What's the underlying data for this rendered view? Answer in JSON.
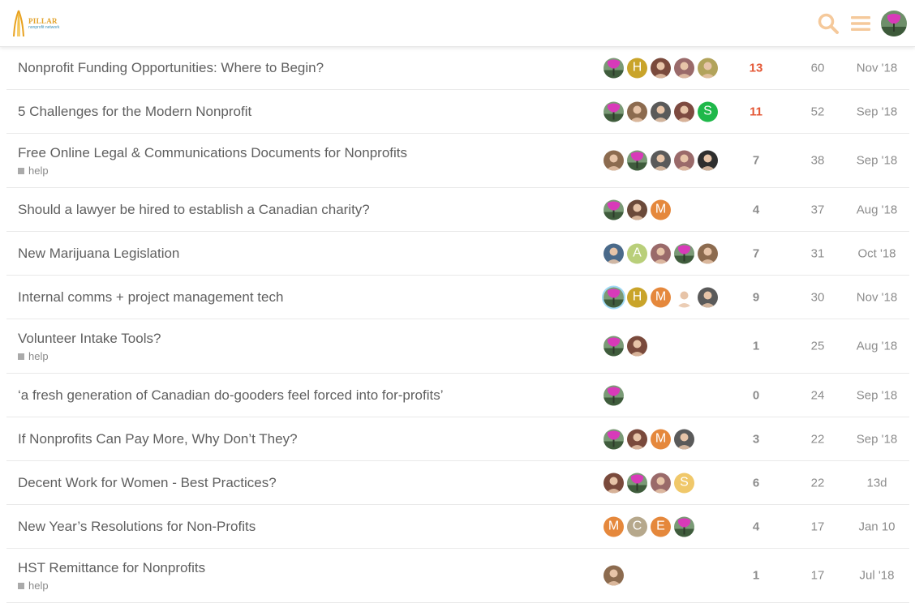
{
  "header": {
    "logo_title": "PILLAR",
    "logo_subtitle": "nonprofit network"
  },
  "colors": {
    "accent": "#f5c99b",
    "hot_replies": "#e45735",
    "magenta": "#d83ab9",
    "avatar_h": "#c9a42a",
    "avatar_m": "#e5883c",
    "avatar_s_green": "#1fb84a",
    "avatar_a": "#b9cf7a",
    "avatar_c": "#b6a88c",
    "avatar_s_yellow": "#f0c86a"
  },
  "topics": [
    {
      "title": "Nonprofit Funding Opportunities: Where to Begin?",
      "tag": "",
      "replies": "13",
      "views": "60",
      "activity": "Nov '18",
      "posters": [
        {
          "type": "flower"
        },
        {
          "type": "letter",
          "letter": "H",
          "color": "#c9a42a"
        },
        {
          "type": "photo",
          "color": "#7a4a3c"
        },
        {
          "type": "photo",
          "color": "#9a6a6a"
        },
        {
          "type": "photo",
          "color": "#b2a35b"
        }
      ]
    },
    {
      "title": "5 Challenges for the Modern Nonprofit",
      "tag": "",
      "replies": "11",
      "views": "52",
      "activity": "Sep '18",
      "posters": [
        {
          "type": "flower"
        },
        {
          "type": "photo",
          "color": "#8c6b4f"
        },
        {
          "type": "photo",
          "color": "#5a5a5a"
        },
        {
          "type": "photo",
          "color": "#7d4a40"
        },
        {
          "type": "letter",
          "letter": "S",
          "color": "#1fb84a"
        }
      ]
    },
    {
      "title": "Free Online Legal & Communications Documents for Nonprofits",
      "tag": "help",
      "replies": "7",
      "views": "38",
      "activity": "Sep '18",
      "posters": [
        {
          "type": "photo",
          "color": "#8c6b4f"
        },
        {
          "type": "flower"
        },
        {
          "type": "photo",
          "color": "#5a5a5a"
        },
        {
          "type": "photo",
          "color": "#9a6a6a"
        },
        {
          "type": "photo",
          "color": "#2e2e2e"
        }
      ]
    },
    {
      "title": "Should a lawyer be hired to establish a Canadian charity?",
      "tag": "",
      "replies": "4",
      "views": "37",
      "activity": "Aug '18",
      "posters": [
        {
          "type": "flower"
        },
        {
          "type": "photo",
          "color": "#6b4a3a"
        },
        {
          "type": "letter",
          "letter": "M",
          "color": "#e5883c"
        }
      ]
    },
    {
      "title": "New Marijuana Legislation",
      "tag": "",
      "replies": "7",
      "views": "31",
      "activity": "Oct '18",
      "posters": [
        {
          "type": "photo",
          "color": "#4a6a8a"
        },
        {
          "type": "letter",
          "letter": "A",
          "color": "#b9cf7a"
        },
        {
          "type": "photo",
          "color": "#9a6a6a"
        },
        {
          "type": "flower"
        },
        {
          "type": "photo",
          "color": "#8c6b4f"
        }
      ]
    },
    {
      "title": "Internal comms + project management tech",
      "tag": "",
      "replies": "9",
      "views": "30",
      "activity": "Nov '18",
      "posters": [
        {
          "type": "flower",
          "latest": true
        },
        {
          "type": "letter",
          "letter": "H",
          "color": "#c9a42a"
        },
        {
          "type": "letter",
          "letter": "M",
          "color": "#e5883c"
        },
        {
          "type": "photo",
          "color": "#ffffff"
        },
        {
          "type": "photo",
          "color": "#5a5a5a"
        }
      ]
    },
    {
      "title": "Volunteer Intake Tools?",
      "tag": "help",
      "replies": "1",
      "views": "25",
      "activity": "Aug '18",
      "posters": [
        {
          "type": "flower"
        },
        {
          "type": "photo",
          "color": "#7a4a3c"
        }
      ]
    },
    {
      "title": "‘a fresh generation of Canadian do-gooders feel forced into for-profits’",
      "tag": "",
      "replies": "0",
      "views": "24",
      "activity": "Sep '18",
      "posters": [
        {
          "type": "flower"
        }
      ]
    },
    {
      "title": "If Nonprofits Can Pay More, Why Don’t They?",
      "tag": "",
      "replies": "3",
      "views": "22",
      "activity": "Sep '18",
      "posters": [
        {
          "type": "flower"
        },
        {
          "type": "photo",
          "color": "#7a4a3c"
        },
        {
          "type": "letter",
          "letter": "M",
          "color": "#e5883c"
        },
        {
          "type": "photo",
          "color": "#5a5a5a"
        }
      ]
    },
    {
      "title": "Decent Work for Women - Best Practices?",
      "tag": "",
      "replies": "6",
      "views": "22",
      "activity": "13d",
      "posters": [
        {
          "type": "photo",
          "color": "#7a4a3c"
        },
        {
          "type": "flower"
        },
        {
          "type": "photo",
          "color": "#9a6a6a"
        },
        {
          "type": "letter",
          "letter": "S",
          "color": "#f0c86a"
        }
      ]
    },
    {
      "title": "New Year’s Resolutions for Non-Profits",
      "tag": "",
      "replies": "4",
      "views": "17",
      "activity": "Jan 10",
      "posters": [
        {
          "type": "letter",
          "letter": "M",
          "color": "#e5883c"
        },
        {
          "type": "letter",
          "letter": "C",
          "color": "#b6a88c"
        },
        {
          "type": "letter",
          "letter": "E",
          "color": "#e5883c"
        },
        {
          "type": "flower"
        }
      ]
    },
    {
      "title": "HST Remittance for Nonprofits",
      "tag": "help",
      "replies": "1",
      "views": "17",
      "activity": "Jul '18",
      "posters": [
        {
          "type": "photo",
          "color": "#8c6b4f"
        }
      ]
    }
  ]
}
